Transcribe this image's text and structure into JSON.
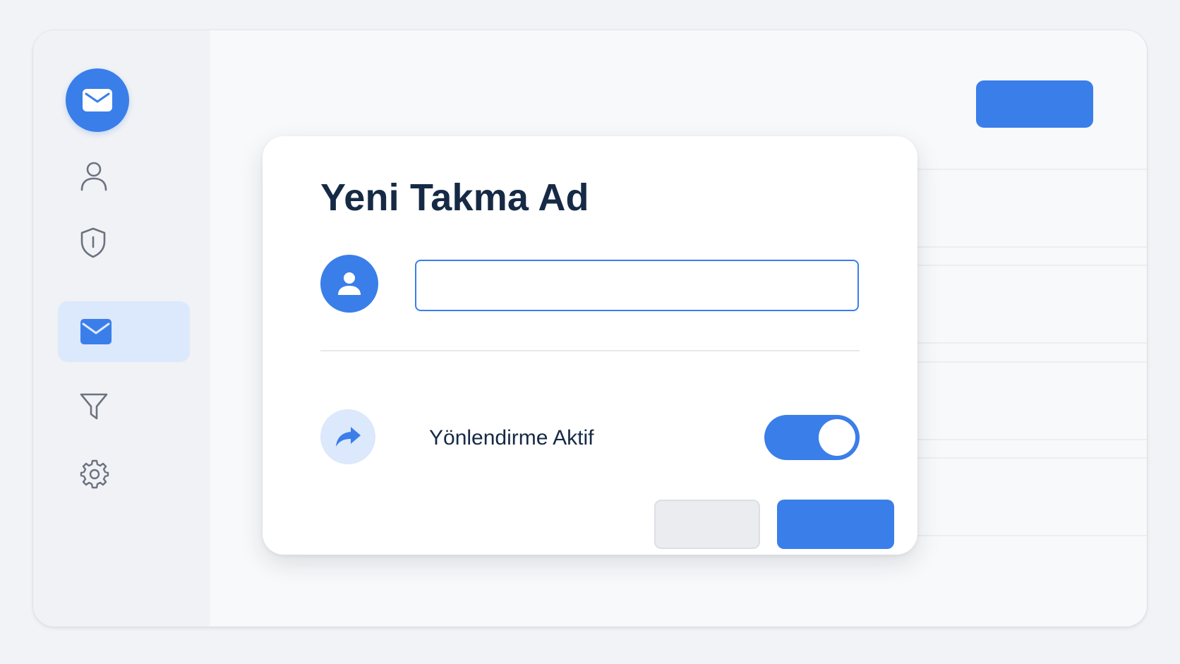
{
  "dialog": {
    "title": "Yeni Takma Ad",
    "alias_input": {
      "value": "",
      "placeholder": ""
    },
    "forwarding": {
      "label": "Yönlendirme Aktif",
      "enabled": true
    },
    "cancel_label": "",
    "save_label": ""
  },
  "header": {
    "action_label": ""
  },
  "sidebar": {
    "logo_icon": "mail-icon",
    "active_item": "aliases",
    "items": [
      {
        "id": "profile",
        "icon": "user-icon"
      },
      {
        "id": "security",
        "icon": "shield-icon"
      },
      {
        "id": "aliases",
        "icon": "mail-icon"
      },
      {
        "id": "filters",
        "icon": "filter-icon"
      },
      {
        "id": "settings",
        "icon": "gear-icon"
      }
    ]
  },
  "colors": {
    "accent": "#3a7ee9",
    "accent_soft": "#dce8fb",
    "text_dark": "#162a45",
    "sidebar_bg": "#f0f2f5",
    "background": "#f1f3f6"
  }
}
